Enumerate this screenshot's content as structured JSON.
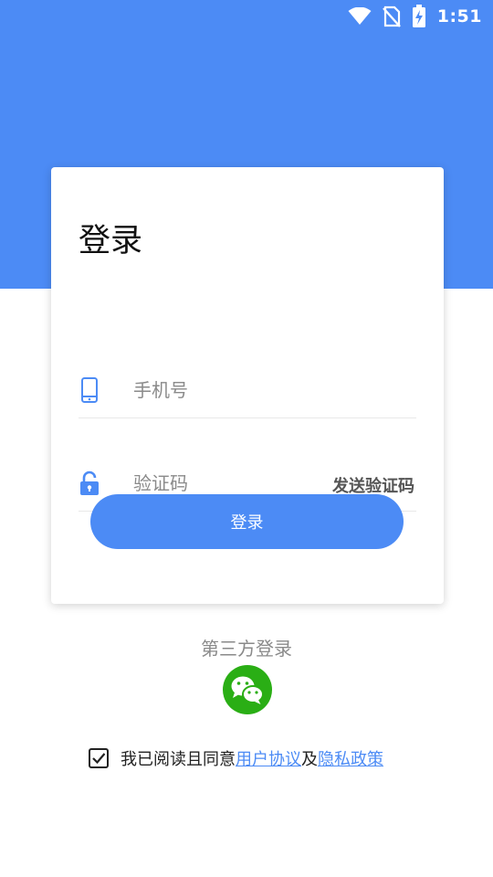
{
  "status_bar": {
    "time": "1:51",
    "icons": [
      "wifi-icon",
      "no-sim-icon",
      "battery-charging-icon"
    ]
  },
  "login_card": {
    "title": "登录",
    "phone_placeholder": "手机号",
    "code_placeholder": "验证码",
    "send_code_label": "发送验证码",
    "login_button_label": "登录"
  },
  "third_party": {
    "label": "第三方登录",
    "icons": [
      "wechat-icon"
    ]
  },
  "agreement": {
    "checked": true,
    "prefix": "我已阅读且同意",
    "user_agreement": "用户协议",
    "connector": "及",
    "privacy_policy": "隐私政策"
  },
  "colors": {
    "primary": "#4c8bf5",
    "wechat_green": "#2aae15",
    "placeholder_gray": "#8a8a8a"
  }
}
